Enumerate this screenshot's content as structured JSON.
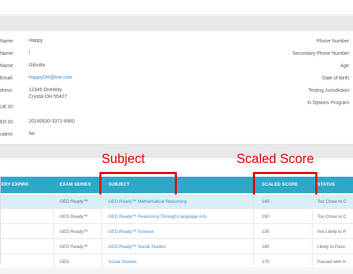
{
  "profile": {
    "left": [
      {
        "label": "Name:",
        "value": "Happy",
        "link": false
      },
      {
        "label": "Name:",
        "value": "I",
        "link": false
      },
      {
        "label": "Name:",
        "value": "Gilcutta",
        "link": false
      },
      {
        "label": "Email:",
        "value": "HappyOH@live.com",
        "link": true
      },
      {
        "label": "dress:",
        "value": "12345 OneWay",
        "link": false
      },
      {
        "label": "",
        "value": "Crystal OH 55427",
        "link": false
      },
      {
        "label": "UE ID:",
        "value": "",
        "link": false
      },
      {
        "label": "ED ID:",
        "value": "20140630-3372-8960",
        "link": false
      },
      {
        "label": "udent:",
        "value": "No",
        "link": false
      }
    ],
    "right": [
      {
        "label": "Phone Number:"
      },
      {
        "label": "Secondary Phone Number:"
      },
      {
        "label": "Age:"
      },
      {
        "label": "Date of Birth:"
      },
      {
        "label": "Testing Jurisdiction:"
      },
      {
        "label": "In Options Program:"
      }
    ]
  },
  "annotations": {
    "subject": "Subject",
    "scaled": "Scaled Score"
  },
  "table": {
    "headers": [
      "ERY EXPIRE",
      "EXAM SERIES",
      "SUBJECT",
      "SCALED SCORE",
      "STATUS"
    ],
    "rows": [
      {
        "series": "GED Ready™",
        "subject": "GED Ready™ Mathematical Reasoning",
        "score": "145",
        "status": "Too Close to C",
        "highlight": true
      },
      {
        "series": "GED Ready™",
        "subject": "GED Ready™ Reasoning Through Language Arts",
        "score": "150",
        "status": "Too Close to C",
        "highlight": false
      },
      {
        "series": "GED Ready™",
        "subject": "GED Ready™ Science",
        "score": "135",
        "status": "Not Likely to P",
        "highlight": false
      },
      {
        "series": "GED Ready™",
        "subject": "GED Ready™ Social Studies",
        "score": "165",
        "status": "Likely to Pass",
        "highlight": false
      },
      {
        "series": "GED",
        "subject": "Social Studies",
        "score": "170",
        "status": "Passed with H",
        "highlight": false
      }
    ]
  },
  "colors": {
    "header_teal": "#2fa8c8",
    "link_blue": "#3a88c8",
    "annotation_red": "#e60000",
    "row_highlight": "#d9eef6"
  }
}
